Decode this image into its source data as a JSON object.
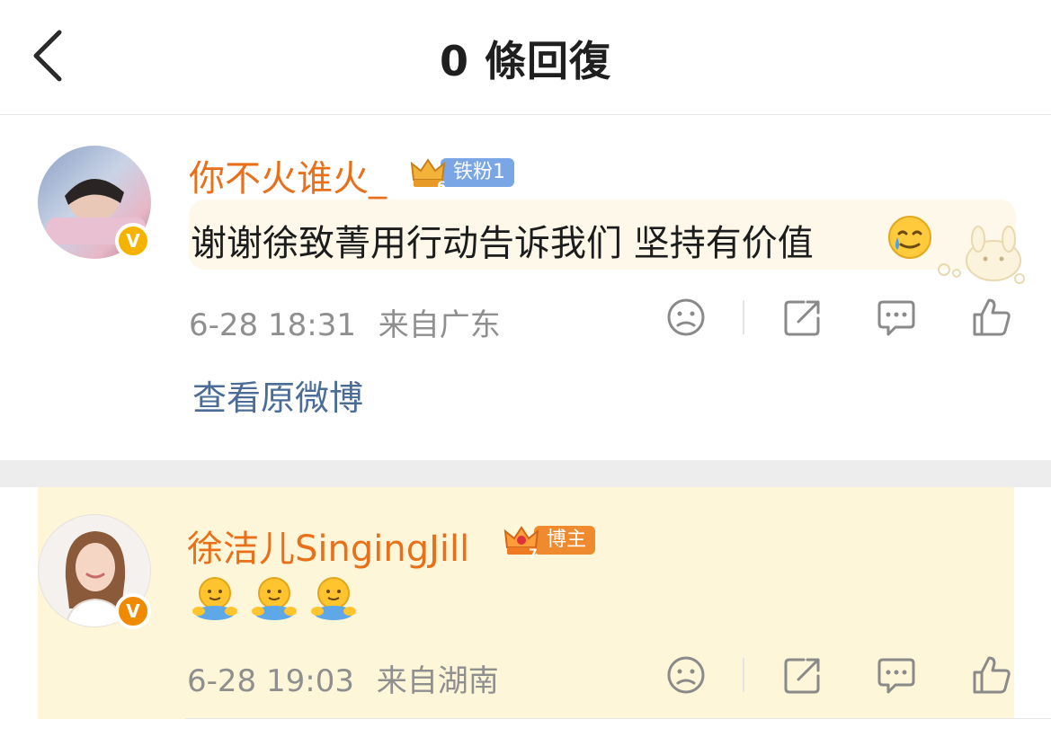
{
  "header": {
    "title": "0 條回復",
    "back_icon": "chevron-left-icon"
  },
  "comments": [
    {
      "username": "你不火谁火_",
      "badge": {
        "level": "6",
        "label": "铁粉1",
        "color": "#7aa6e6"
      },
      "verified_icon": "v-badge-icon",
      "text": "谢谢徐致菁用行动告诉我们 坚持有价值",
      "emoji": "crying-smile-emoji",
      "time": "6-28 18:31",
      "location": "来自广东",
      "link": "查看原微博"
    },
    {
      "username": "徐洁儿SingingJill",
      "badge": {
        "level": "7",
        "label": "博主",
        "color": "#f08a2e"
      },
      "verified_icon": "v-badge-icon",
      "emojis": [
        "hug-emoji",
        "hug-emoji",
        "hug-emoji"
      ],
      "time": "6-28 19:03",
      "location": "来自湖南"
    }
  ],
  "actions": [
    "dislike-face-icon",
    "share-icon",
    "comment-icon",
    "like-icon"
  ],
  "colors": {
    "username": "#e8701a",
    "link": "#4a6c96",
    "highlight": "#fdf6d8",
    "meta": "#8f8f8f"
  }
}
